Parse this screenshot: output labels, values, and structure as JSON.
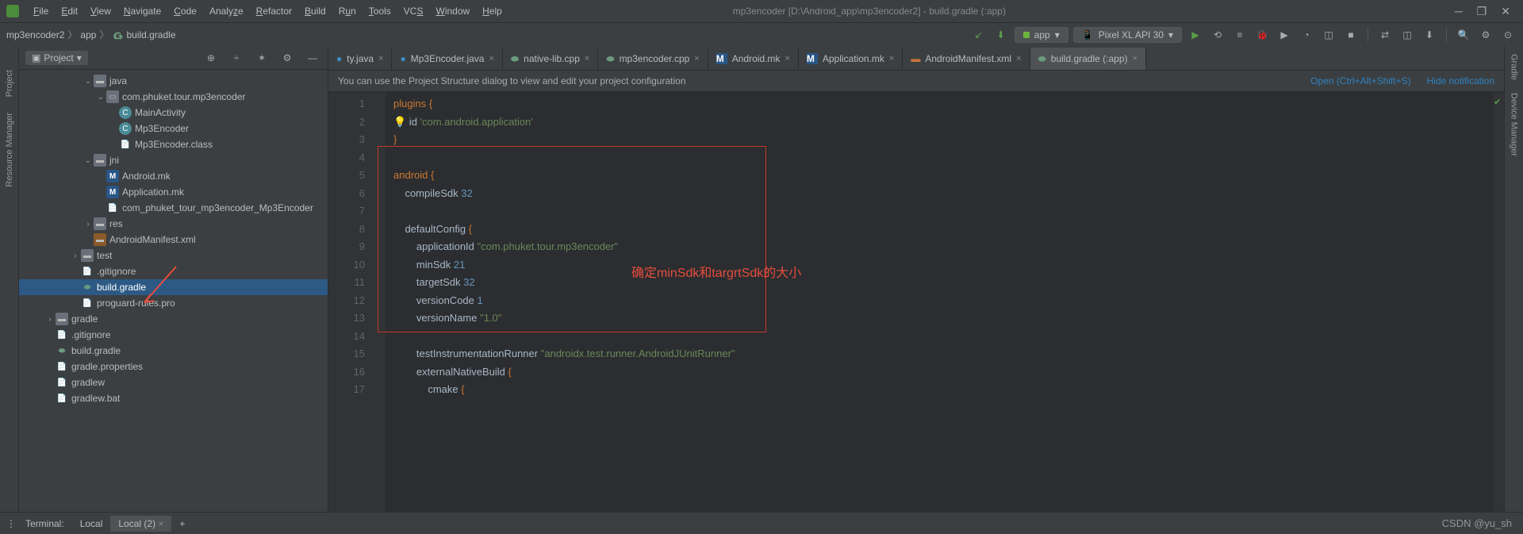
{
  "title": "mp3encoder [D:\\Android_app\\mp3encoder2] - build.gradle (:app)",
  "menu": [
    "File",
    "Edit",
    "View",
    "Navigate",
    "Code",
    "Analyze",
    "Refactor",
    "Build",
    "Run",
    "Tools",
    "VCS",
    "Window",
    "Help"
  ],
  "breadcrumb": {
    "root": "mp3encoder2",
    "mid": "app",
    "file": "build.gradle"
  },
  "run_config": "app",
  "device": "Pixel XL API 30",
  "sidebar_title": "Project",
  "tree": [
    {
      "indent": 5,
      "arrow": "v",
      "icon": "folder",
      "label": "java"
    },
    {
      "indent": 6,
      "arrow": "v",
      "icon": "pkg",
      "label": "com.phuket.tour.mp3encoder"
    },
    {
      "indent": 7,
      "arrow": "",
      "icon": "cls",
      "iconText": "C",
      "label": "MainActivity"
    },
    {
      "indent": 7,
      "arrow": "",
      "icon": "cls",
      "iconText": "C",
      "label": "Mp3Encoder"
    },
    {
      "indent": 7,
      "arrow": "",
      "icon": "file",
      "label": "Mp3Encoder.class"
    },
    {
      "indent": 5,
      "arrow": "v",
      "icon": "folder",
      "label": "jni"
    },
    {
      "indent": 6,
      "arrow": "",
      "icon": "mk",
      "iconText": "M",
      "label": "Android.mk"
    },
    {
      "indent": 6,
      "arrow": "",
      "icon": "mk",
      "iconText": "M",
      "label": "Application.mk"
    },
    {
      "indent": 6,
      "arrow": "",
      "icon": "file",
      "label": "com_phuket_tour_mp3encoder_Mp3Encoder"
    },
    {
      "indent": 5,
      "arrow": ">",
      "icon": "folder",
      "label": "res"
    },
    {
      "indent": 5,
      "arrow": "",
      "icon": "xml",
      "label": "AndroidManifest.xml"
    },
    {
      "indent": 4,
      "arrow": ">",
      "icon": "folder",
      "label": "test"
    },
    {
      "indent": 4,
      "arrow": "",
      "icon": "file",
      "label": ".gitignore"
    },
    {
      "indent": 4,
      "arrow": "",
      "icon": "gradle",
      "label": "build.gradle",
      "selected": true
    },
    {
      "indent": 4,
      "arrow": "",
      "icon": "file",
      "label": "proguard-rules.pro"
    },
    {
      "indent": 2,
      "arrow": ">",
      "icon": "folder",
      "label": "gradle"
    },
    {
      "indent": 2,
      "arrow": "",
      "icon": "file",
      "label": ".gitignore"
    },
    {
      "indent": 2,
      "arrow": "",
      "icon": "gradle",
      "label": "build.gradle"
    },
    {
      "indent": 2,
      "arrow": "",
      "icon": "file",
      "label": "gradle.properties"
    },
    {
      "indent": 2,
      "arrow": "",
      "icon": "file",
      "label": "gradlew"
    },
    {
      "indent": 2,
      "arrow": "",
      "icon": "file",
      "label": "gradlew.bat"
    }
  ],
  "tabs": [
    {
      "icon": "j",
      "label": "ty.java",
      "active": false
    },
    {
      "icon": "j",
      "label": "Mp3Encoder.java",
      "active": false
    },
    {
      "icon": "c",
      "label": "native-lib.cpp",
      "active": false
    },
    {
      "icon": "c",
      "label": "mp3encoder.cpp",
      "active": false
    },
    {
      "icon": "mk",
      "label": "Android.mk",
      "active": false
    },
    {
      "icon": "mk",
      "label": "Application.mk",
      "active": false
    },
    {
      "icon": "xml",
      "label": "AndroidManifest.xml",
      "active": false
    },
    {
      "icon": "gradle",
      "label": "build.gradle (:app)",
      "active": true
    }
  ],
  "info_bar": {
    "msg": "You can use the Project Structure dialog to view and edit your project configuration",
    "link1": "Open (Ctrl+Alt+Shift+S)",
    "link2": "Hide notification"
  },
  "code_lines": [
    1,
    2,
    3,
    4,
    5,
    6,
    7,
    8,
    9,
    10,
    11,
    12,
    13,
    14,
    15,
    16,
    17
  ],
  "annotation": "确定minSdk和targrtSdk的大小",
  "terminal": {
    "label": "Terminal:",
    "tabs": [
      "Local",
      "Local (2)"
    ]
  },
  "right_rail": [
    "Gradle",
    "Device Manager"
  ],
  "left_rail": [
    "Project",
    "Resource Manager"
  ],
  "watermark": "CSDN @yu_sh"
}
